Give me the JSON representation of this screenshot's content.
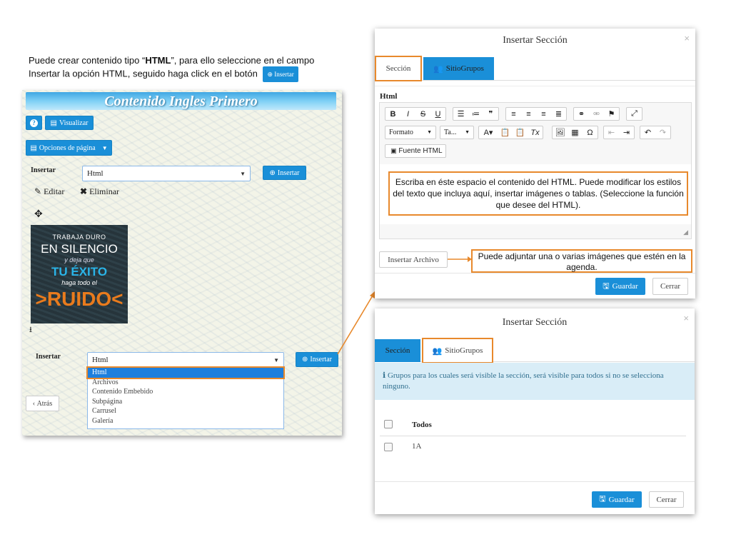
{
  "intro": {
    "line1_pre": "Puede crear contenido tipo “",
    "line1_bold": "HTML",
    "line1_post": "”, para ello seleccione en el campo",
    "line2": "Insertar la opción HTML, seguido haga click en el botón",
    "button": "Insertar"
  },
  "left": {
    "banner": "Contenido Ingles Primero",
    "visualizar": "Visualizar",
    "opciones": "Opciones de página",
    "insert_label": "Insertar",
    "select_value": "Html",
    "insert_button": "Insertar",
    "editar": "Editar",
    "eliminar": "Eliminar",
    "image_text": {
      "t1": "TRABAJA DURO",
      "t2": "EN SILENCIO",
      "t3": "y deja que",
      "t4": "TU ÉXITO",
      "t5": "haga todo el",
      "t6": ">RUIDO<"
    },
    "insert_label2": "Insertar",
    "select_value2": "Html",
    "insert_button2": "Insertar",
    "options": [
      "Html",
      "Archivos",
      "Contenido Embebido",
      "Subpágina",
      "Carrusel",
      "Galería"
    ],
    "atras": "Atrás"
  },
  "dialog1": {
    "title": "Insertar Sección",
    "close": "×",
    "tab_seccion": "Sección",
    "tab_grupos": "SitioGrupos",
    "field_label": "Html",
    "formato": "Formato",
    "tamano": "Ta...",
    "fuente": "Fuente HTML",
    "editor_note": "Escriba en éste espacio el contenido del HTML. Puede modificar los estilos del texto que incluya aquí, insertar imágenes o tablas. (Seleccione la función que desee del HTML).",
    "insertar_archivo": "Insertar Archivo",
    "archivo_note": "Puede adjuntar una o varias imágenes que estén en la agenda.",
    "guardar": "Guardar",
    "cerrar": "Cerrar"
  },
  "dialog2": {
    "title": "Insertar Sección",
    "close": "×",
    "tab_seccion": "Sección",
    "tab_grupos": "SitioGrupos",
    "info": "Grupos para los cuales será visible la sección, será visible para todos si no se selecciona ninguno.",
    "todos": "Todos",
    "group1": "1A",
    "guardar": "Guardar",
    "cerrar": "Cerrar"
  },
  "colors": {
    "primary": "#1a8fd8",
    "highlight": "#e8892c"
  }
}
